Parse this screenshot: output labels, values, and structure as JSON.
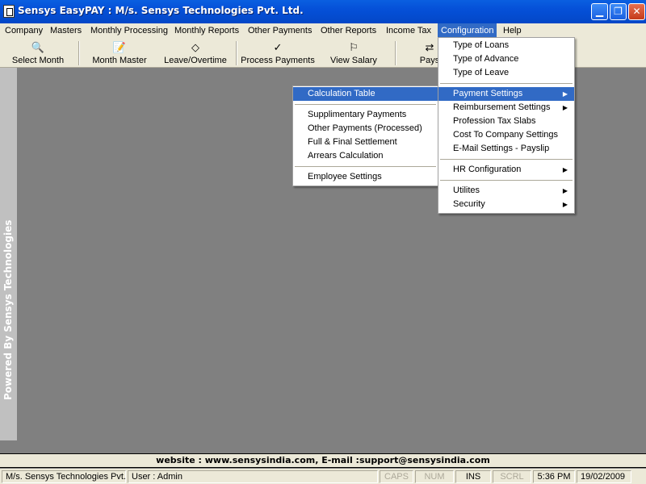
{
  "window": {
    "title": "Sensys EasyPAY : M/s. Sensys Technologies Pvt. Ltd.",
    "min_icon": "minimize-icon",
    "max_icon": "restore-icon",
    "close_icon": "close-icon"
  },
  "menubar": {
    "items": [
      "Company",
      "Masters",
      "Monthly Processing",
      "Monthly Reports",
      "Other Payments",
      "Other Reports",
      "Income Tax",
      "Configuration",
      "Help"
    ],
    "active": "Configuration"
  },
  "toolbar": {
    "buttons": [
      {
        "label": "Select Month",
        "icon": "calendar-search-icon",
        "glyph": "🔍"
      },
      {
        "label": "Month Master",
        "icon": "document-edit-icon",
        "glyph": "📝"
      },
      {
        "label": "Leave/Overtime",
        "icon": "diamond-icon",
        "glyph": "◇"
      },
      {
        "label": "Process Payments",
        "icon": "checkmark-icon",
        "glyph": "✓"
      },
      {
        "label": "View Salary",
        "icon": "sign-post-icon",
        "glyph": "⚐"
      },
      {
        "label": "Pays",
        "icon": "payslip-icon",
        "glyph": "⇄"
      }
    ]
  },
  "sideband": {
    "text": "Powered By Sensys Technologies"
  },
  "configuration_menu": {
    "items": [
      {
        "label": "Type of Loans",
        "submenu": false
      },
      {
        "label": "Type of Advance",
        "submenu": false
      },
      {
        "label": "Type of Leave",
        "submenu": false
      },
      {
        "sep": true
      },
      {
        "label": "Payment Settings",
        "submenu": true,
        "highlighted": true
      },
      {
        "label": "Reimbursement Settings",
        "submenu": true
      },
      {
        "label": "Profession Tax Slabs",
        "submenu": false
      },
      {
        "label": "Cost To Company Settings",
        "submenu": false
      },
      {
        "label": "E-Mail Settings - Payslip",
        "submenu": false
      },
      {
        "sep": true
      },
      {
        "label": "HR Configuration",
        "submenu": true
      },
      {
        "sep": true
      },
      {
        "label": "Utilites",
        "submenu": true
      },
      {
        "label": "Security",
        "submenu": true
      }
    ]
  },
  "payment_settings_submenu": {
    "items": [
      {
        "label": "Calculation Table",
        "highlighted": true
      },
      {
        "sep": true
      },
      {
        "label": "Supplimentary Payments"
      },
      {
        "label": "Other Payments (Processed)"
      },
      {
        "label": "Full & Final Settlement"
      },
      {
        "label": "Arrears Calculation"
      },
      {
        "sep": true
      },
      {
        "label": "Employee Settings"
      }
    ]
  },
  "footer": {
    "website": "website : www.sensysindia.com, E-mail :support@sensysindia.com"
  },
  "statusbar": {
    "company": "M/s. Sensys Technologies Pvt.",
    "user": "User : Admin",
    "caps": "CAPS",
    "num": "NUM",
    "ins": "INS",
    "scrl": "SCRL",
    "time": "5:36 PM",
    "date": "19/02/2009"
  },
  "colors": {
    "titlebar": "#0550d8",
    "highlight": "#316ac5",
    "workspace": "#808080",
    "chrome": "#ece9d8"
  }
}
